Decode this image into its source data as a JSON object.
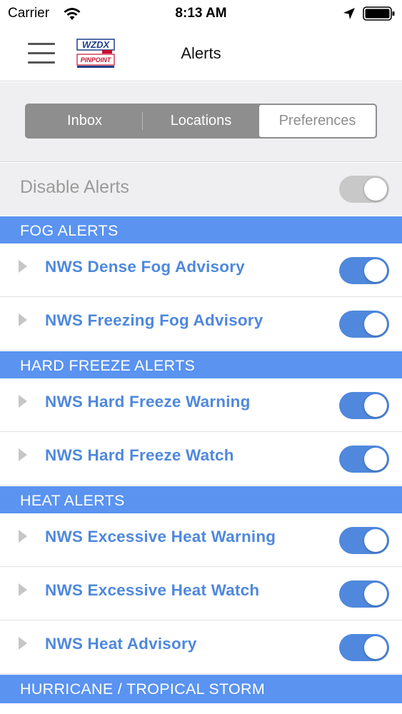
{
  "status_bar": {
    "carrier": "Carrier",
    "time": "8:13 AM",
    "icons": [
      "wifi-icon",
      "location-arrow-icon",
      "battery-icon"
    ]
  },
  "nav": {
    "title": "Alerts",
    "menu_icon": "hamburger-menu-icon",
    "logo_text_top": "WZDX",
    "logo_text_bottom": "PINPOINT"
  },
  "segments": {
    "items": [
      "Inbox",
      "Locations",
      "Preferences"
    ],
    "selected": "Preferences"
  },
  "disable_alerts": {
    "label": "Disable Alerts",
    "on": false
  },
  "sections": [
    {
      "header": "FOG ALERTS",
      "items": [
        {
          "label": "NWS Dense Fog Advisory",
          "on": true
        },
        {
          "label": "NWS Freezing Fog Advisory",
          "on": true
        }
      ]
    },
    {
      "header": "HARD FREEZE ALERTS",
      "items": [
        {
          "label": "NWS Hard Freeze Warning",
          "on": true
        },
        {
          "label": "NWS Hard Freeze Watch",
          "on": true
        }
      ]
    },
    {
      "header": "HEAT ALERTS",
      "items": [
        {
          "label": "NWS Excessive Heat Warning",
          "on": true
        },
        {
          "label": "NWS Excessive Heat Watch",
          "on": true
        },
        {
          "label": "NWS Heat Advisory",
          "on": true
        }
      ]
    },
    {
      "header": "HURRICANE / TROPICAL STORM",
      "items": []
    }
  ],
  "colors": {
    "accent": "#4f88dd",
    "section_header": "#5a93f0",
    "toggle_disabled": "#c8c8c8",
    "segment_bg": "#8e8e8e",
    "background": "#efeff1"
  }
}
